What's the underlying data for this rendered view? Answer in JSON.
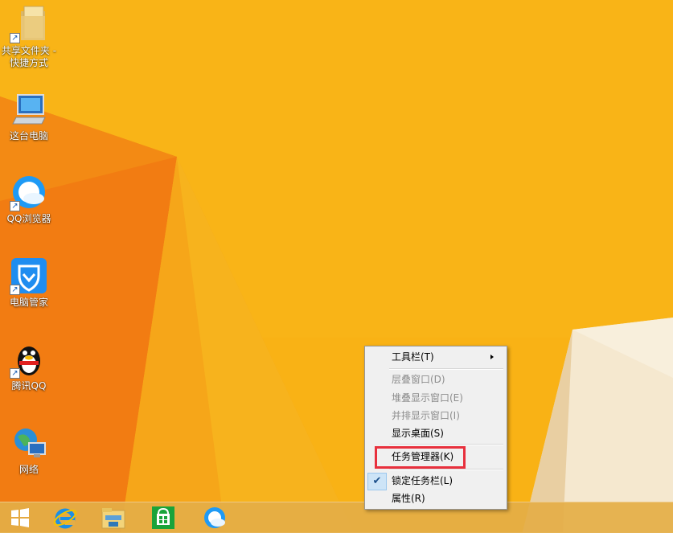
{
  "desktop": {
    "icons": [
      {
        "label_line1": "共享文件夹 -",
        "label_line2": "快捷方式",
        "icon": "folder-icon",
        "shortcut": true
      },
      {
        "label": "这台电脑",
        "icon": "computer-icon",
        "shortcut": false
      },
      {
        "label": "QQ浏览器",
        "icon": "qq-browser-icon",
        "shortcut": true
      },
      {
        "label": "电脑管家",
        "icon": "pc-manager-icon",
        "shortcut": true
      },
      {
        "label": "腾讯QQ",
        "icon": "qq-penguin-icon",
        "shortcut": true
      },
      {
        "label": "网络",
        "icon": "network-icon",
        "shortcut": false
      }
    ],
    "shortcut_arrow": "↗"
  },
  "context_menu": {
    "items": [
      {
        "label": "工具栏(T)",
        "enabled": true,
        "has_submenu": true
      },
      {
        "label": "层叠窗口(D)",
        "enabled": false
      },
      {
        "label": "堆叠显示窗口(E)",
        "enabled": false
      },
      {
        "label": "并排显示窗口(I)",
        "enabled": false
      },
      {
        "label": "显示桌面(S)",
        "enabled": true
      },
      {
        "label": "任务管理器(K)",
        "enabled": true,
        "highlighted": true
      },
      {
        "label": "锁定任务栏(L)",
        "enabled": true,
        "checked": true
      },
      {
        "label": "属性(R)",
        "enabled": true
      }
    ],
    "check_mark": "✔",
    "highlight_color": "#e8303d"
  },
  "taskbar": {
    "buttons": [
      "windows-start-icon",
      "internet-explorer-icon",
      "file-explorer-icon",
      "store-icon",
      "qq-browser-icon"
    ]
  },
  "colors": {
    "wallpaper": "#f8b014",
    "menu_background": "#f0f0f0"
  }
}
